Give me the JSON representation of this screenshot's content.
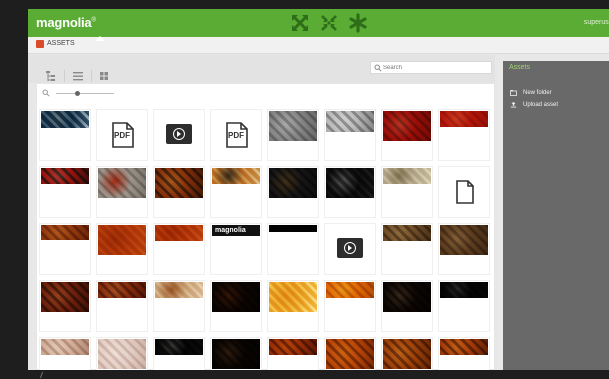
{
  "app": {
    "logo_text": "magnolia",
    "logo_mark": "®",
    "user": "superuser",
    "brand_color": "#5aac34",
    "top_icons": [
      "move-cross-icon",
      "collapse-arrows-icon",
      "asterisk-icon"
    ]
  },
  "breadcrumb": {
    "label": "ASSETS"
  },
  "search": {
    "placeholder": "Search"
  },
  "toolbar": {
    "views": [
      "tree-view-icon",
      "list-view-icon",
      "thumbnail-view-icon"
    ],
    "active_view": "thumbnail-view-icon"
  },
  "actions": {
    "title": "Assets",
    "items": [
      {
        "label": "New folder",
        "icon": "folder-plus-icon"
      },
      {
        "label": "Upload asset",
        "icon": "upload-icon"
      }
    ]
  },
  "thumbs": [
    {
      "kind": "img",
      "colors": [
        "#3a5f79",
        "#7b8a92",
        "#cfd8dc"
      ],
      "h": 0.34
    },
    {
      "kind": "pdf",
      "label": "PDF"
    },
    {
      "kind": "video"
    },
    {
      "kind": "pdf",
      "label": "PDF"
    },
    {
      "kind": "img",
      "colors": [
        "#b9b9b9",
        "#e8e8e8",
        "#8c8c8c"
      ],
      "h": 0.6
    },
    {
      "kind": "img",
      "colors": [
        "#d9d9d9",
        "#f5f5f5",
        "#9a9a9a"
      ],
      "h": 0.42
    },
    {
      "kind": "img",
      "colors": [
        "#c83a2a",
        "#e9dcd4",
        "#8f3022"
      ],
      "h": 0.6
    },
    {
      "kind": "img",
      "colors": [
        "#d74a2c",
        "#f0c9b4",
        "#b8382a"
      ],
      "h": 0.32
    },
    {
      "kind": "img",
      "colors": [
        "#c6423a",
        "#ddc7b5",
        "#4b3a33"
      ],
      "h": 0.32
    },
    {
      "kind": "img",
      "colors": [
        "#c8c3bd",
        "#d43a1c",
        "#9c978f"
      ],
      "h": 0.6
    },
    {
      "kind": "img",
      "colors": [
        "#b86e33",
        "#e7c68a",
        "#5a3a20"
      ],
      "h": 0.6
    },
    {
      "kind": "img",
      "colors": [
        "#d8a35a",
        "#3b3732",
        "#efe0c2"
      ],
      "h": 0.32
    },
    {
      "kind": "img",
      "colors": [
        "#4a4a4a",
        "#e1a455",
        "#2b2b2b"
      ],
      "h": 0.6
    },
    {
      "kind": "img",
      "colors": [
        "#2c2c2c",
        "#ededed",
        "#5a5a5a"
      ],
      "h": 0.6
    },
    {
      "kind": "img",
      "colors": [
        "#d2cbb7",
        "#8f8566",
        "#efe9d9"
      ],
      "h": 0.32
    },
    {
      "kind": "doc"
    },
    {
      "kind": "img",
      "colors": [
        "#c27a3c",
        "#e7b77a",
        "#8e4d22"
      ],
      "h": 0.3
    },
    {
      "kind": "img",
      "colors": [
        "#cf6f2a",
        "#b55512",
        "#e08e47"
      ],
      "h": 0.6
    },
    {
      "kind": "img",
      "colors": [
        "#cf6a26",
        "#b95511",
        "#e2904e"
      ],
      "h": 0.32
    },
    {
      "kind": "logo",
      "label": "magnolia"
    },
    {
      "kind": "img",
      "colors": [
        "#111111",
        "#1f3a2a",
        "#0b0b0b"
      ],
      "h": 0.14
    },
    {
      "kind": "video"
    },
    {
      "kind": "img",
      "colors": [
        "#a98c64",
        "#d8c2a0",
        "#6f5a3d"
      ],
      "h": 0.32
    },
    {
      "kind": "img",
      "colors": [
        "#9a7c58",
        "#d9c3a1",
        "#6d563b"
      ],
      "h": 0.6
    },
    {
      "kind": "img",
      "colors": [
        "#a65a36",
        "#e4b58c",
        "#5c2f1b"
      ],
      "h": 0.6
    },
    {
      "kind": "img",
      "colors": [
        "#b86a3c",
        "#e2b48a",
        "#7c3e1e"
      ],
      "h": 0.32
    },
    {
      "kind": "img",
      "colors": [
        "#e1c8a8",
        "#a4622e",
        "#f3e7d6"
      ],
      "h": 0.32
    },
    {
      "kind": "img",
      "colors": [
        "#3a2212",
        "#e8a345",
        "#1c1008"
      ],
      "h": 0.6
    },
    {
      "kind": "img",
      "colors": [
        "#f1c452",
        "#e9a82b",
        "#fff3c6"
      ],
      "h": 0.6
    },
    {
      "kind": "img",
      "colors": [
        "#f0a326",
        "#fde4a0",
        "#c57a12"
      ],
      "h": 0.32
    },
    {
      "kind": "img",
      "colors": [
        "#3a2a1e",
        "#f7e7cf",
        "#1a120c"
      ],
      "h": 0.6
    },
    {
      "kind": "img",
      "colors": [
        "#151515",
        "#e9e9e9",
        "#2b2b2b"
      ],
      "h": 0.32
    },
    {
      "kind": "img",
      "colors": [
        "#e8d3c6",
        "#faf2ec",
        "#c4a898"
      ],
      "h": 0.32
    },
    {
      "kind": "img",
      "colors": [
        "#f1e6e1",
        "#fbf7f5",
        "#d9c5bb"
      ],
      "h": 0.6
    },
    {
      "kind": "img",
      "colors": [
        "#1a1a1a",
        "#f3f0ea",
        "#3b3b3b"
      ],
      "h": 0.32
    },
    {
      "kind": "img",
      "colors": [
        "#2f2015",
        "#f5d79c",
        "#1a110a"
      ],
      "h": 0.6
    },
    {
      "kind": "img",
      "colors": [
        "#c46b21",
        "#f0a23b",
        "#7a3b10"
      ],
      "h": 0.32
    },
    {
      "kind": "img",
      "colors": [
        "#d9852c",
        "#f1bb62",
        "#8f4e12"
      ],
      "h": 0.6
    },
    {
      "kind": "img",
      "colors": [
        "#c7802f",
        "#f1c27a",
        "#7e4817"
      ],
      "h": 0.6
    },
    {
      "kind": "img",
      "colors": [
        "#cc7a2c",
        "#f3c68a",
        "#7b4415"
      ],
      "h": 0.32
    }
  ]
}
